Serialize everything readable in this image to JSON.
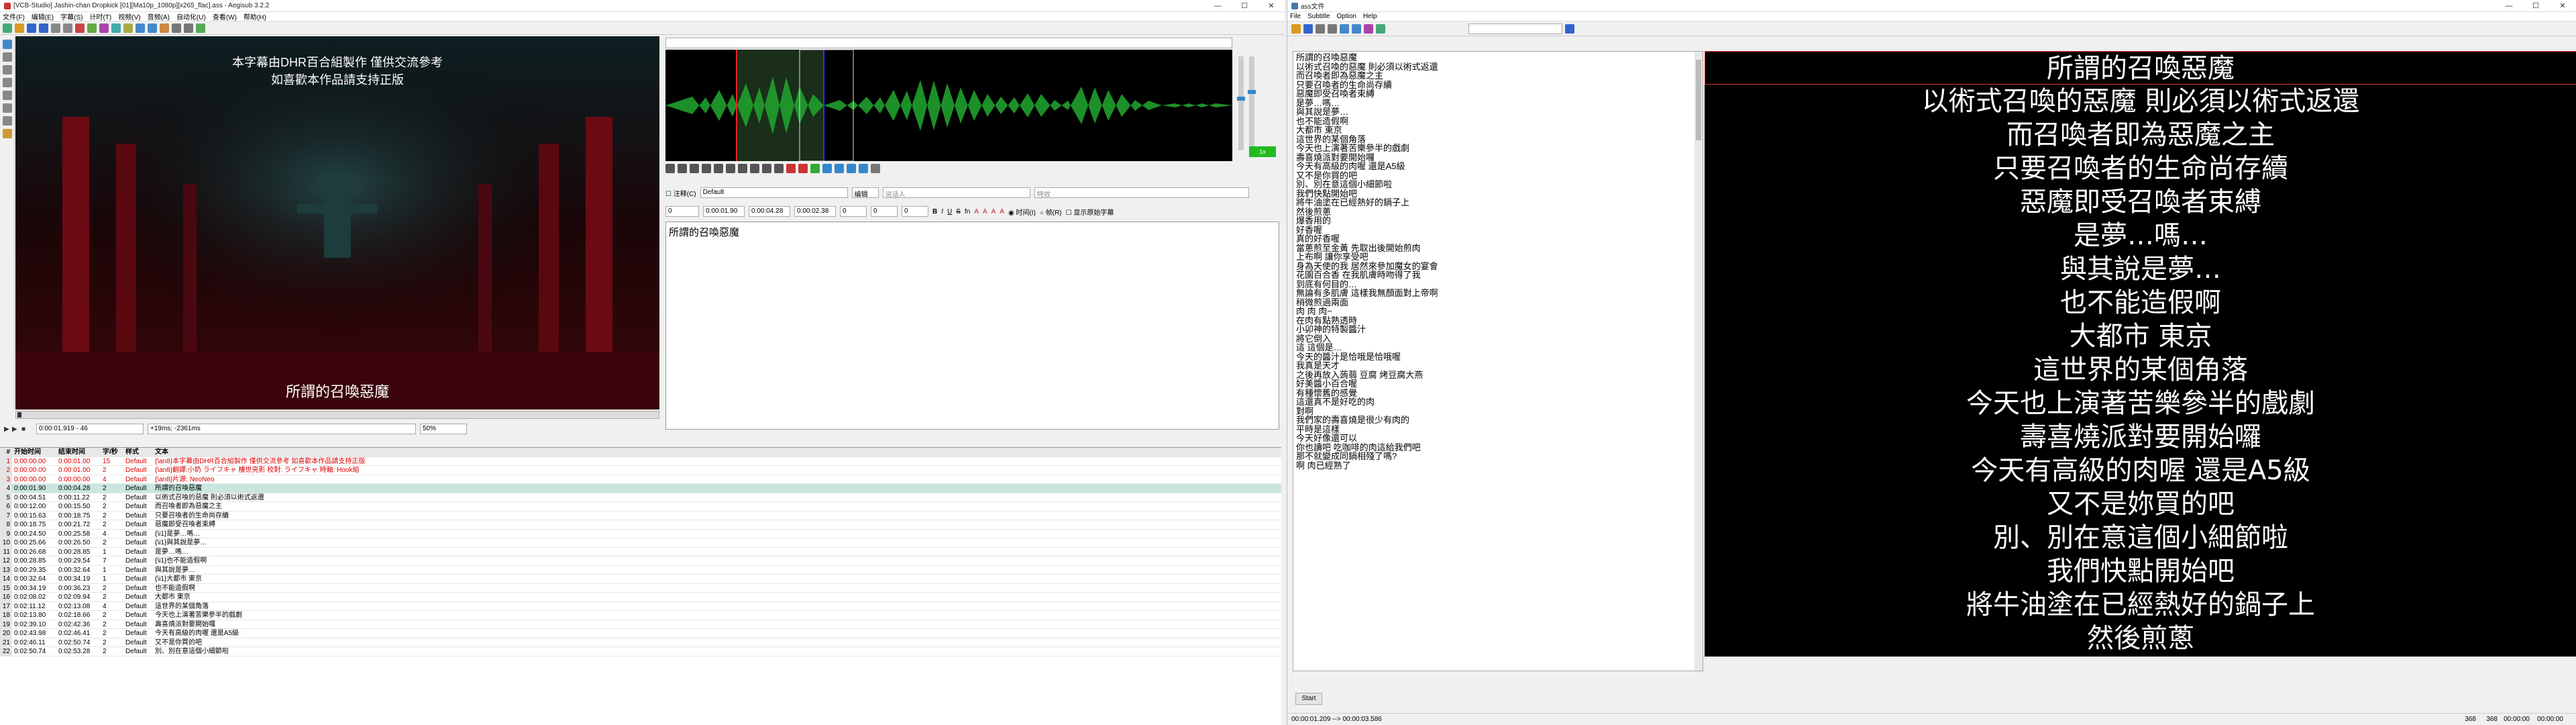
{
  "left": {
    "title": "[VCB-Studio] Jashin-chan Dropkick [01][Ma10p_1080p][x265_flac].ass - Aegisub 3.2.2",
    "window_buttons": [
      "—",
      "☐",
      "✕"
    ],
    "menu": [
      "文件(F)",
      "编辑(E)",
      "字幕(S)",
      "计时(T)",
      "视频(V)",
      "音频(A)",
      "自动化(U)",
      "查看(W)",
      "帮助(H)"
    ],
    "video": {
      "top_line1": "本字幕由DHR百合組製作 僅供交流參考",
      "top_line2": "如喜歡本作品請支持正版",
      "bottom": "所謂的召喚惡魔"
    },
    "video_controls": {
      "time": "0:00:01.919 - 46",
      "offset": "+19ms; -2361ms",
      "zoom": "50%"
    },
    "audio": {
      "record_label": "1x"
    },
    "edit": {
      "comment_label": "注释(C)",
      "style": "Default",
      "edit_btn": "编辑",
      "actor_placeholder": "说话人",
      "effect_placeholder": "特效",
      "layer": "0",
      "start": "0:00:01.90",
      "end": "0:00:04.28",
      "duration": "0:00:02.38",
      "ml": "0",
      "mr": "0",
      "mv": "0",
      "time_label": "时间(I)",
      "frame_label": "帧(R)",
      "show_original": "显示原始字幕",
      "text": "所謂的召喚惡魔"
    },
    "grid": {
      "headers": [
        "#",
        "开始时间",
        "结束时间",
        "字/秒",
        "样式",
        "文本"
      ],
      "rows": [
        [
          "1",
          "0:00:00.00",
          "0:00:01.00",
          "15",
          "Default",
          "{\\an8}本字幕由DHR百合組製作 僅供交流參考 如喜歡本作品請支持正版"
        ],
        [
          "2",
          "0:00:00.00",
          "0:00:01.00",
          "2",
          "Default",
          "{\\an8}翻譯:小奶 ライフキャ 樓世亮影 校對: ライフキャ 時軸: Hook組"
        ],
        [
          "3",
          "0:00:00.00",
          "0:00:00.00",
          "4",
          "Default",
          "{\\an8}片源: NeoNeo"
        ],
        [
          "4",
          "0:00:01.90",
          "0:00:04.28",
          "2",
          "Default",
          "所謂的召喚惡魔"
        ],
        [
          "5",
          "0:00:04.51",
          "0:00:11.22",
          "2",
          "Default",
          "以術式召喚的惡魔 則必須以術式返還"
        ],
        [
          "6",
          "0:00:12.00",
          "0:00:15.50",
          "2",
          "Default",
          "而召喚者即為惡魔之主"
        ],
        [
          "7",
          "0:00:15.63",
          "0:00:18.75",
          "2",
          "Default",
          "只要召喚者的生命尚存續"
        ],
        [
          "8",
          "0:00:18.75",
          "0:00:21.72",
          "2",
          "Default",
          "惡魔即受召喚者束縛"
        ],
        [
          "9",
          "0:00:24.50",
          "0:00:25.58",
          "4",
          "Default",
          "{\\i1}是夢…嗎…"
        ],
        [
          "10",
          "0:00:25.66",
          "0:00:26.50",
          "2",
          "Default",
          "{\\i1}與其說是夢…"
        ],
        [
          "11",
          "0:00:26.68",
          "0:00:28.85",
          "1",
          "Default",
          "是夢…嗎…"
        ],
        [
          "12",
          "0:00:28.85",
          "0:00:29.54",
          "7",
          "Default",
          "{\\i1}也不能造假啊"
        ],
        [
          "13",
          "0:00:29.35",
          "0:00:32.64",
          "1",
          "Default",
          "與其說是夢…"
        ],
        [
          "14",
          "0:00:32.64",
          "0:00:34.19",
          "1",
          "Default",
          "{\\i1}大都市 東京"
        ],
        [
          "15",
          "0:00:34.19",
          "0:00:36.23",
          "2",
          "Default",
          "也不能造假啊"
        ],
        [
          "16",
          "0:02:08.02",
          "0:02:09.94",
          "2",
          "Default",
          "大都市 東京"
        ],
        [
          "17",
          "0:02:11.12",
          "0:02:13.08",
          "4",
          "Default",
          "這世界的某個角落"
        ],
        [
          "18",
          "0:02:13.80",
          "0:02:18.66",
          "2",
          "Default",
          "今天也上演著苦樂參半的戲劇"
        ],
        [
          "19",
          "0:02:39.10",
          "0:02:42.36",
          "2",
          "Default",
          "壽喜燒派對要開始囉"
        ],
        [
          "20",
          "0:02:43.98",
          "0:02:46.41",
          "2",
          "Default",
          "今天有高級的肉喔 還是A5級"
        ],
        [
          "21",
          "0:02:46.11",
          "0:02:50.74",
          "2",
          "Default",
          "又不是你買的吧"
        ],
        [
          "22",
          "0:02:50.74",
          "0:02:53.28",
          "2",
          "Default",
          "別、別在意這個小細節啦"
        ]
      ]
    }
  },
  "right": {
    "title": "ass文件",
    "menu": [
      "File",
      "Subtitle",
      "Option",
      "Help"
    ],
    "window_buttons": [
      "—",
      "☐",
      "✕"
    ],
    "subtitle_lines": [
      "所謂的召喚惡魔",
      "以術式召喚的惡魔 則必須以術式返還",
      "而召喚者即為惡魔之主",
      "只要召喚者的生命尚存續",
      "惡魔即受召喚者束縛",
      "是夢…嗎…",
      "與其說是夢…",
      "也不能造假啊",
      "大都市 東京",
      "這世界的某個角落",
      "今天也上演著苦樂參半的戲劇",
      "壽喜燒派對要開始囉",
      "今天有高級的肉喔 還是A5級",
      "又不是你買的吧",
      "別、別在意這個小細節啦",
      "我們快點開始吧",
      "將牛油塗在已經熱好的鍋子上",
      "然後煎蔥",
      "爆香用的",
      "好香喔",
      "真的好香喔",
      "當蔥煎至金黃 先取出後開始煎肉",
      "上布啊 讓你享受吧",
      "身為天使的我 居然來參加魔女的宴會",
      "花園百合香 在我肌膚時吻得了我",
      "到底有何目的…",
      "無論有多肌膚 這樣我無顏面對上帝啊",
      "稍微煎過兩面",
      "肉 肉 肉~",
      "在肉有點熟透時",
      "小卯神的特製醬汁",
      "將它倒入",
      "這 這個是…",
      "今天的醬汁是恰哦是恰哦喔",
      "我真是天才",
      "之後再放入蒟蒻 豆腐 烤豆腐大燕",
      "好美醬小百合喔",
      "有種懷舊的感覺",
      "這還真不是好吃的肉",
      "對啊",
      "我們家的壽喜燒是很少有肉的",
      "平時是這樣",
      "今天好像還可以",
      "你也讀吧 吃咖啡的肉這給我們吧",
      "那不就變成同鍋相殘了嗎?",
      "啊 肉已經熟了"
    ],
    "preview_lines": [
      "所謂的召喚惡魔",
      "以術式召喚的惡魔 則必須以術式返還",
      "而召喚者即為惡魔之主",
      "只要召喚者的生命尚存續",
      "惡魔即受召喚者束縛",
      "是夢…嗎…",
      "與其說是夢…",
      "也不能造假啊",
      "大都市 東京",
      "這世界的某個角落",
      "今天也上演著苦樂參半的戲劇",
      "壽喜燒派對要開始囉",
      "今天有高級的肉喔 還是A5級",
      "又不是妳買的吧",
      "別、別在意這個小細節啦",
      "我們快點開始吧",
      "將牛油塗在已經熱好的鍋子上",
      "然後煎蔥"
    ],
    "start_btn": "Start",
    "status_left": "00:00:01.209 --> 00:00:03.586",
    "status_right": [
      "368",
      "368",
      "00:00:00",
      "00:00:00"
    ]
  }
}
